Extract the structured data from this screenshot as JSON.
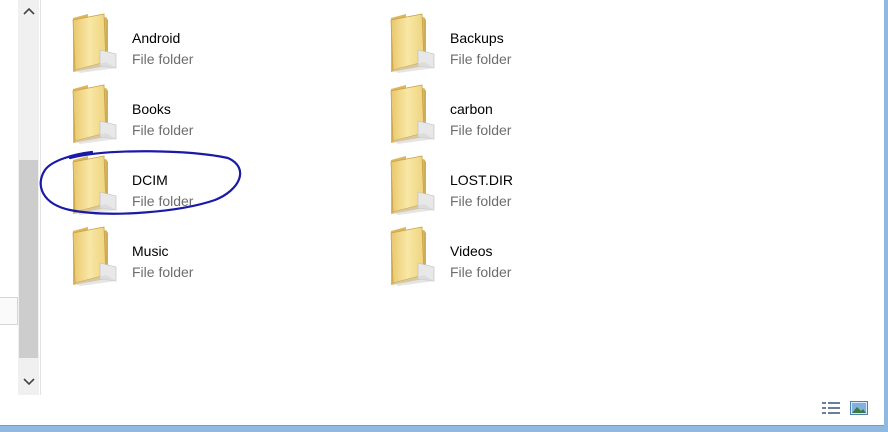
{
  "folders": [
    {
      "name": "Android",
      "type": "File folder"
    },
    {
      "name": "Backups",
      "type": "File folder"
    },
    {
      "name": "Books",
      "type": "File folder"
    },
    {
      "name": "carbon",
      "type": "File folder"
    },
    {
      "name": "DCIM",
      "type": "File folder"
    },
    {
      "name": "LOST.DIR",
      "type": "File folder"
    },
    {
      "name": "Music",
      "type": "File folder"
    },
    {
      "name": "Videos",
      "type": "File folder"
    }
  ],
  "highlighted_folder": "DCIM",
  "colors": {
    "highlight_oval": "#1a1aa8",
    "folder_light": "#f8e7a6",
    "folder_dark": "#e0be62",
    "window_frame": "#8fb9e0"
  },
  "icons": {
    "folder": "folder-icon",
    "scroll_up": "chevron-up-icon",
    "scroll_down": "chevron-down-icon",
    "details_view": "details-view-icon",
    "large_icons_view": "large-icons-view-icon"
  }
}
